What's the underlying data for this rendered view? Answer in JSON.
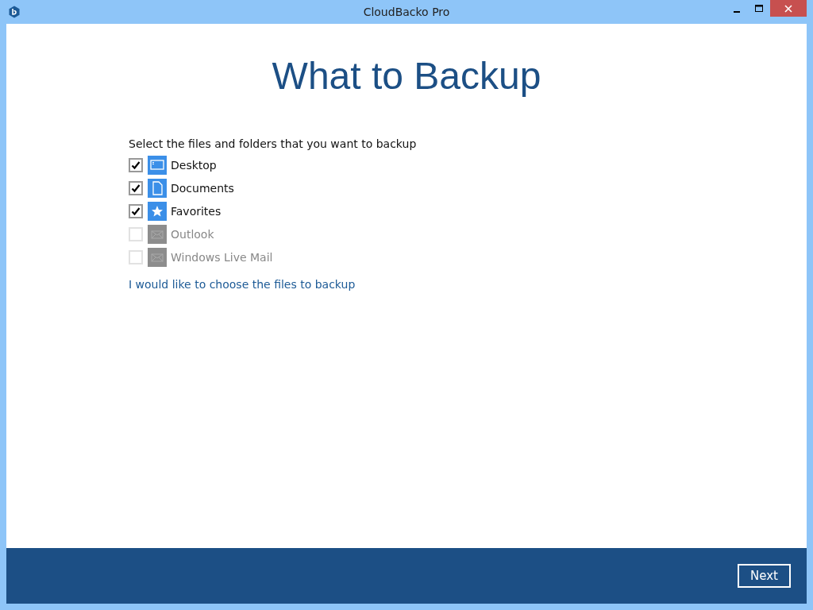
{
  "window": {
    "title": "CloudBacko Pro"
  },
  "heading": "What to Backup",
  "prompt": "Select the files and folders that you want to backup",
  "items": [
    {
      "label": "Desktop",
      "kind": "desktop",
      "checked": true,
      "disabled": false
    },
    {
      "label": "Documents",
      "kind": "document",
      "checked": true,
      "disabled": false
    },
    {
      "label": "Favorites",
      "kind": "star",
      "checked": true,
      "disabled": false
    },
    {
      "label": "Outlook",
      "kind": "mail",
      "checked": false,
      "disabled": true
    },
    {
      "label": "Windows Live Mail",
      "kind": "mail",
      "checked": false,
      "disabled": true
    }
  ],
  "choose_link": "I would like to choose the files to backup",
  "buttons": [
    "Next"
  ]
}
